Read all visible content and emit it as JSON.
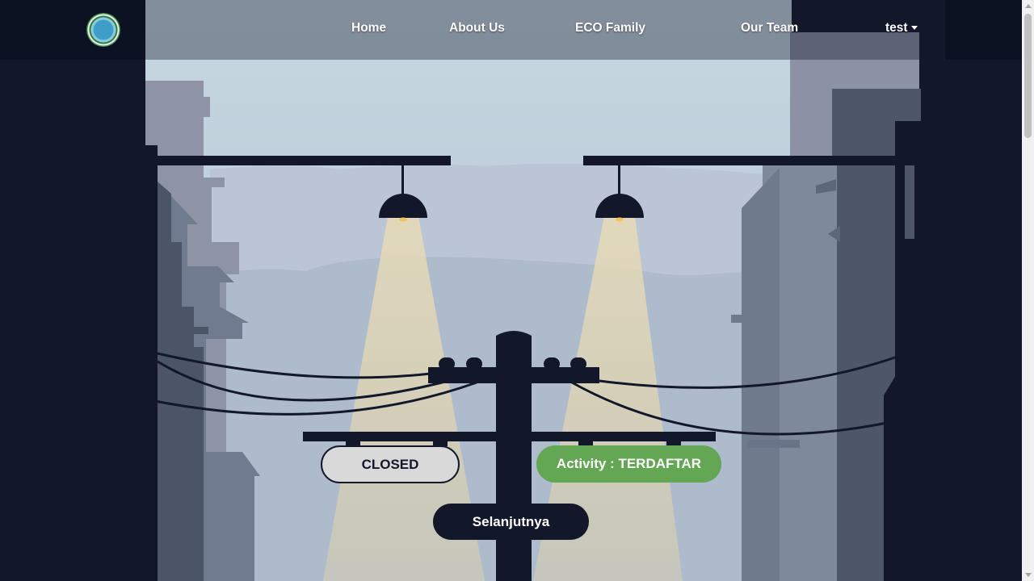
{
  "nav": {
    "logo_icon": "earth-globe-emblem",
    "links": [
      {
        "label": "Home"
      },
      {
        "label": "About Us"
      },
      {
        "label": "ECO Family"
      },
      {
        "label": "Our Team"
      }
    ],
    "user_dropdown": {
      "label": "test"
    }
  },
  "status": {
    "closed_label": "CLOSED",
    "activity_label": "Activity : TERDAFTAR",
    "next_label": "Selanjutnya"
  },
  "colors": {
    "dark_navy": "#12182a",
    "activity_green": "#63a653",
    "closed_gray": "#d9d9d9",
    "sky": "#c6d5e0",
    "lamp_glow": "#dcd6b6"
  }
}
